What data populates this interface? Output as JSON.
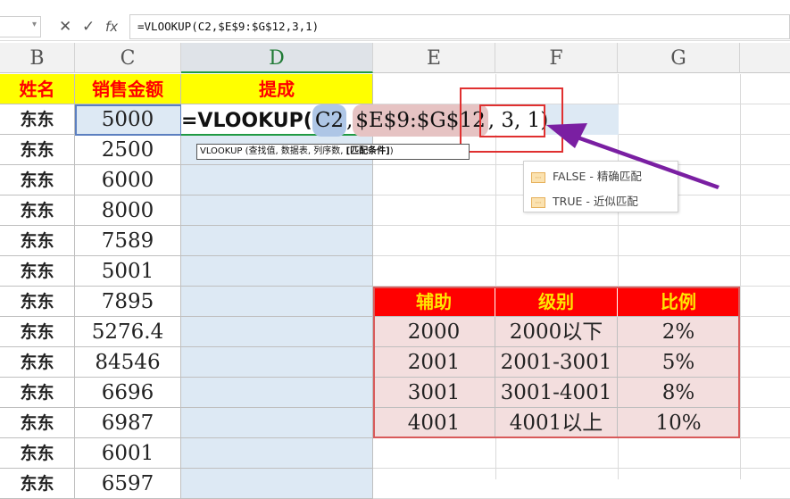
{
  "formula_bar": {
    "cancel_icon": "✕",
    "enter_icon": "✓",
    "fx_label": "fx",
    "formula": "=VLOOKUP(C2,$E$9:$G$12,3,1)"
  },
  "columns": [
    "B",
    "C",
    "D",
    "E",
    "F",
    "G"
  ],
  "header_row": {
    "name": "姓名",
    "sales": "销售金额",
    "commission": "提成"
  },
  "rows": [
    {
      "name": "东东",
      "sales": "5000"
    },
    {
      "name": "东东",
      "sales": "2500"
    },
    {
      "name": "东东",
      "sales": "6000"
    },
    {
      "name": "东东",
      "sales": "8000"
    },
    {
      "name": "东东",
      "sales": "7589"
    },
    {
      "name": "东东",
      "sales": "5001"
    },
    {
      "name": "东东",
      "sales": "7895"
    },
    {
      "name": "东东",
      "sales": "5276.4"
    },
    {
      "name": "东东",
      "sales": "84546"
    },
    {
      "name": "东东",
      "sales": "6696"
    },
    {
      "name": "东东",
      "sales": "6987"
    },
    {
      "name": "东东",
      "sales": "6001"
    },
    {
      "name": "东东",
      "sales": "6597"
    }
  ],
  "cell_formula": {
    "prefix": "=VLOOKUP(",
    "ref1": "C2",
    "sep1": ", ",
    "ref2": "$E$9:$G$12",
    "rest": ", 3, 1)"
  },
  "tooltip": {
    "text": "VLOOKUP (查找值, 数据表, 列序数, ",
    "bold": "[匹配条件]",
    "close": ")"
  },
  "autocomplete": [
    {
      "label": "FALSE - 精确匹配",
      "icon": "function-icon"
    },
    {
      "label": "TRUE - 近似匹配",
      "icon": "function-icon"
    }
  ],
  "lookup_table": {
    "headers": [
      "辅助",
      "级别",
      "比例"
    ],
    "rows": [
      [
        "2000",
        "2000以下",
        "2%"
      ],
      [
        "2001",
        "2001-3001",
        "5%"
      ],
      [
        "3001",
        "3001-4001",
        "8%"
      ],
      [
        "4001",
        "4001以上",
        "10%"
      ]
    ]
  },
  "colors": {
    "highlight_box": "#e03030",
    "arrow": "#7a1fa2",
    "header_yellow": "#ffff00",
    "table_red": "#ff0000"
  }
}
